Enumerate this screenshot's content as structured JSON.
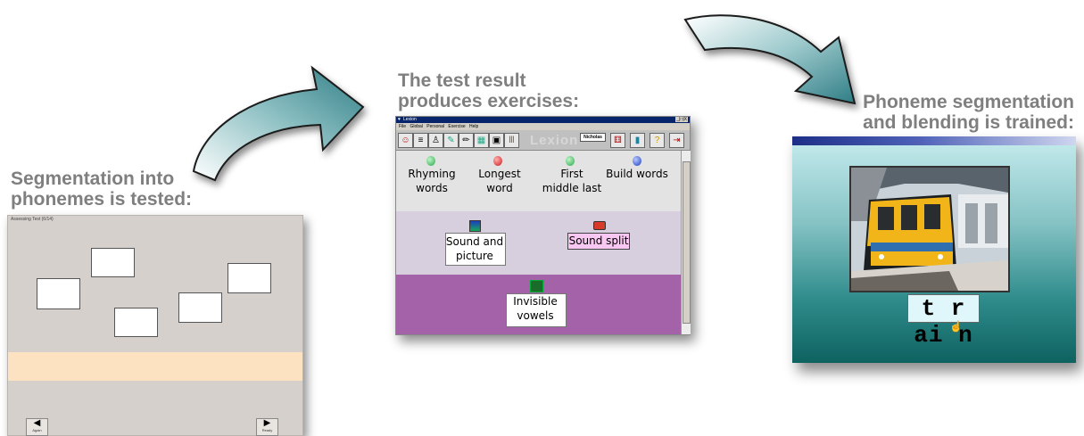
{
  "captions": {
    "step1": [
      "Segmentation into",
      "phonemes is tested:"
    ],
    "step2": [
      "The test result",
      "produces exercises:"
    ],
    "step3": [
      "Phoneme segmentation",
      "and blending is trained:"
    ]
  },
  "panel1": {
    "window_title": "Assessing Test (6/14)",
    "nav_left_label": "Again",
    "nav_right_label": "Ready",
    "band_color": "#fde2c2"
  },
  "panel2": {
    "window_title": "Lexion",
    "window_buttons": "_|□|X",
    "menu": [
      "File",
      "Global",
      "Personal",
      "Exercise",
      "Help"
    ],
    "logo_text": "Lexion",
    "user_name": "Nicholas",
    "exercises_row1": [
      {
        "line1": "Rhyming",
        "line2": "words",
        "dot_color": "#2aa84a"
      },
      {
        "line1": "Longest",
        "line2": "word",
        "dot_color": "#d01818"
      },
      {
        "line1": "First",
        "line2": "middle last",
        "dot_color": "#2aa84a"
      },
      {
        "line1": "Build words",
        "line2": "",
        "dot_color": "#1c3fc0"
      }
    ],
    "exercises_row2": [
      {
        "line1": "Sound and",
        "line2": "picture"
      },
      {
        "line1": "Sound split",
        "line2": ""
      }
    ],
    "exercises_row3": [
      {
        "line1": "Invisible",
        "line2": "vowels"
      }
    ],
    "highlight_color": "#f8c8f2"
  },
  "panel3": {
    "word": "t r ai n"
  }
}
